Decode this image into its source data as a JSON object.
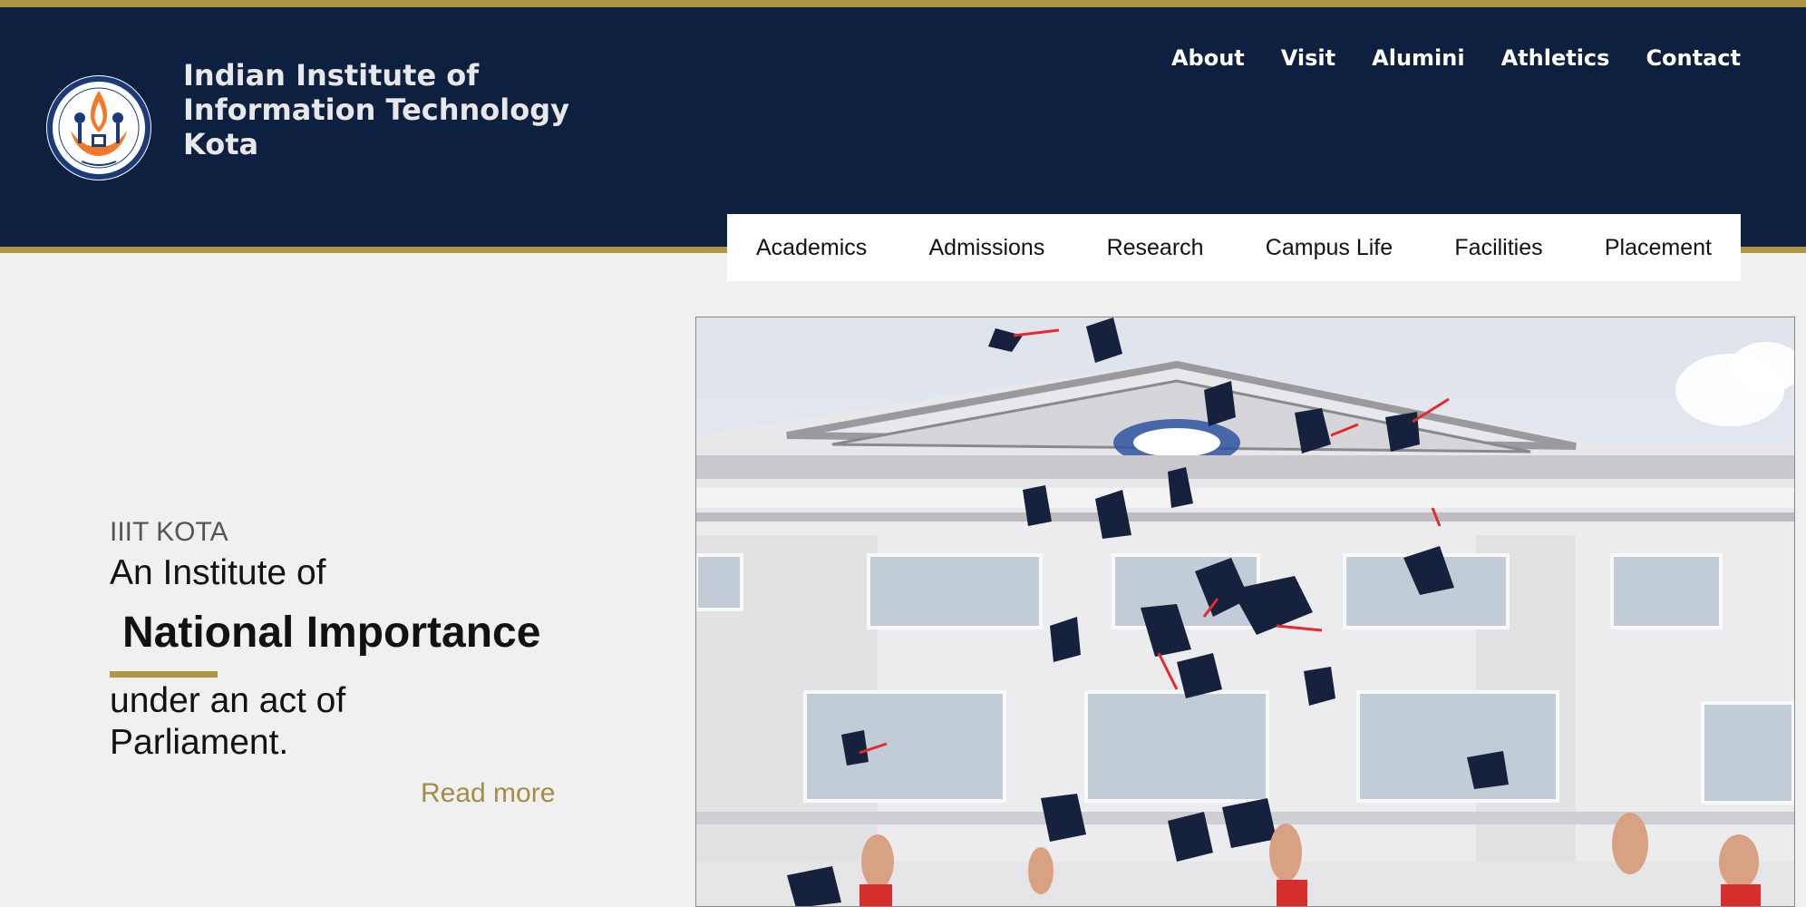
{
  "header": {
    "institute_name_line1": "Indian Institute of",
    "institute_name_line2": "Information Technology",
    "institute_name_line3": "Kota"
  },
  "top_nav": [
    "About",
    "Visit",
    "Alumini",
    "Athletics",
    "Contact"
  ],
  "main_nav": [
    "Academics",
    "Admissions",
    "Research",
    "Campus Life",
    "Facilities",
    "Placement"
  ],
  "hero": {
    "eyebrow": "IIIT KOTA",
    "line1": "An Institute of",
    "highlight": "National Importance",
    "line3": "under an act of Parliament.",
    "read_more": "Read more",
    "image_alt_icon": "graduation-caps-photo"
  },
  "colors": {
    "navy": "#0e203f",
    "gold": "#b09544",
    "page_bg": "#f0f0f0"
  }
}
